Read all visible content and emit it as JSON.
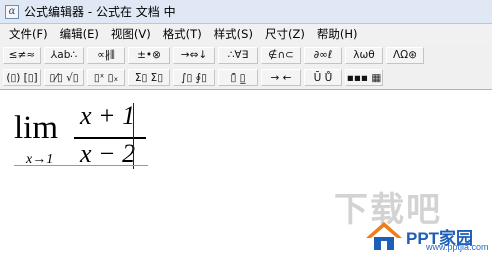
{
  "window": {
    "title": "公式编辑器 - 公式在 文档 中"
  },
  "menu": {
    "items": [
      "文件(F)",
      "编辑(E)",
      "视图(V)",
      "格式(T)",
      "样式(S)",
      "尺寸(Z)",
      "帮助(H)"
    ]
  },
  "toolbar_row1": {
    "buttons": [
      "≤≠≈",
      "⅄ab∴",
      "∝∦⫼",
      "±•⊗",
      "→⇔↓",
      "∴∀∃",
      "∉∩⊂",
      "∂∞ℓ",
      "λωθ",
      "ΛΩ⊛"
    ]
  },
  "toolbar_row2": {
    "buttons": [
      "(▯) [▯]",
      "▯⁄▯ √▯",
      "▯ˣ ▯ₓ",
      "Σ▯ Σ▯",
      "∫▯ ∮▯",
      "▯̄ ▯̲",
      "→ ←",
      "Ū Ů",
      "▪▪▪ ▦"
    ]
  },
  "equation": {
    "operator": "lim",
    "subscript": "x→1",
    "numerator": "x + 1",
    "denominator": "x − 2"
  },
  "watermark": {
    "large": "下载吧",
    "brand": "PPT家园",
    "url": "www.pptjia.com"
  }
}
